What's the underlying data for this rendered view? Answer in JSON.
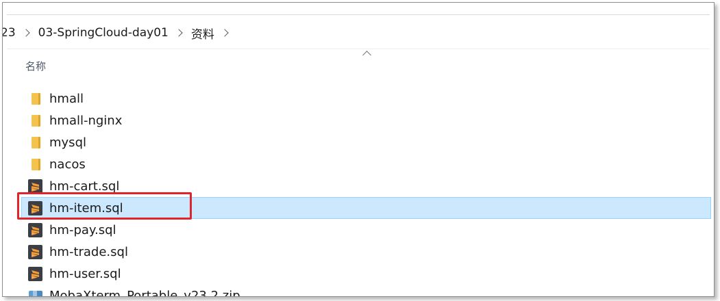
{
  "breadcrumb": {
    "items": [
      {
        "label": "23"
      },
      {
        "label": "03-SpringCloud-day01"
      },
      {
        "label": "资料"
      }
    ]
  },
  "column_header": {
    "name_label": "名称"
  },
  "files": [
    {
      "name": "hmall",
      "icon": "folder-icon",
      "selected": false
    },
    {
      "name": "hmall-nginx",
      "icon": "folder-icon",
      "selected": false
    },
    {
      "name": "mysql",
      "icon": "folder-icon",
      "selected": false
    },
    {
      "name": "nacos",
      "icon": "folder-icon",
      "selected": false
    },
    {
      "name": "hm-cart.sql",
      "icon": "sql-file-icon",
      "selected": false
    },
    {
      "name": "hm-item.sql",
      "icon": "sql-file-icon",
      "selected": true
    },
    {
      "name": "hm-pay.sql",
      "icon": "sql-file-icon",
      "selected": false
    },
    {
      "name": "hm-trade.sql",
      "icon": "sql-file-icon",
      "selected": false
    },
    {
      "name": "hm-user.sql",
      "icon": "sql-file-icon",
      "selected": false
    },
    {
      "name": "MobaXterm_Portable_v23.2.zip",
      "icon": "zip-file-icon",
      "selected": false
    }
  ],
  "colors": {
    "selection_bg": "#cce8ff",
    "selection_border": "#99d1ff",
    "annotation_red": "#e0242b",
    "folder_yellow": "#f3c24f",
    "sublime_orange": "#f79b33"
  }
}
